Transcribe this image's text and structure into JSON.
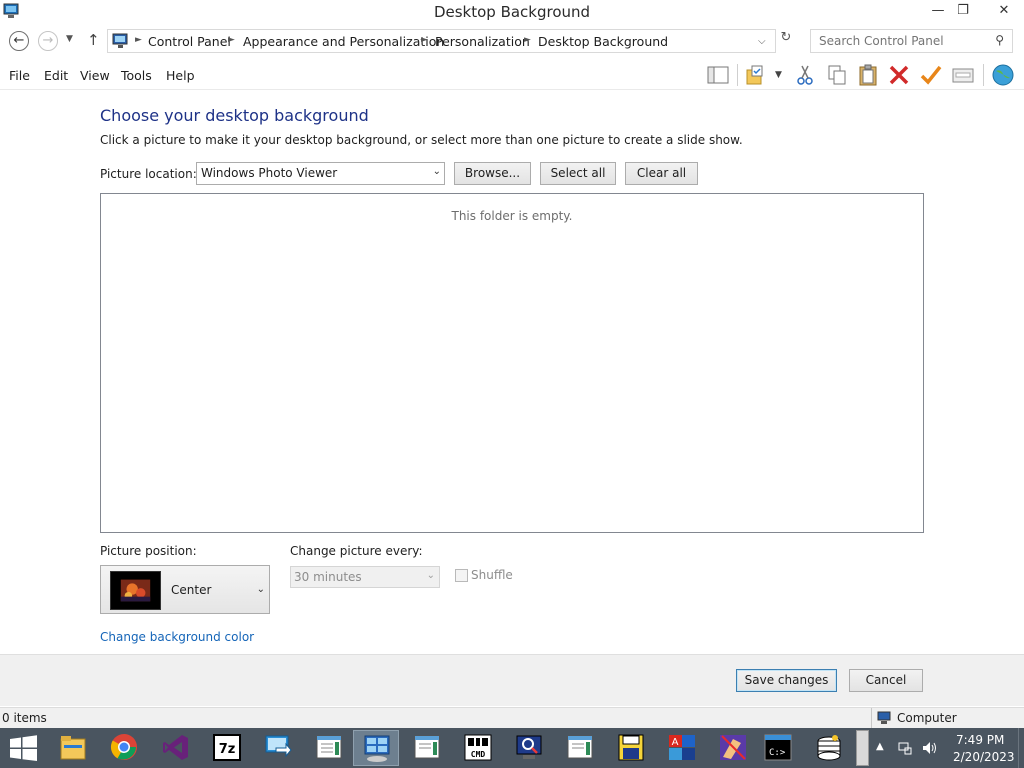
{
  "window": {
    "title": "Desktop Background"
  },
  "address_bar": {
    "breadcrumbs": [
      "Control Panel",
      "Appearance and Personalization",
      "Personalization",
      "Desktop Background"
    ],
    "search_placeholder": "Search Control Panel"
  },
  "menu": {
    "items": [
      "File",
      "Edit",
      "View",
      "Tools",
      "Help"
    ]
  },
  "toolbar": {
    "icons": [
      "layout-pane-icon",
      "folder-options-icon",
      "cut-icon",
      "copy-icon",
      "paste-icon",
      "delete-icon",
      "checkmark-icon",
      "properties-icon",
      "globe-icon"
    ]
  },
  "content": {
    "heading": "Choose your desktop background",
    "subtext": "Click a picture to make it your desktop background, or select more than one picture to create a slide show.",
    "picture_location_label": "Picture location:",
    "picture_location_value": "Windows Photo Viewer",
    "browse_label": "Browse...",
    "select_all_label": "Select all",
    "clear_all_label": "Clear all",
    "empty_message": "This folder is empty.",
    "picture_position_label": "Picture position:",
    "picture_position_value": "Center",
    "change_every_label": "Change picture every:",
    "change_every_value": "30 minutes",
    "shuffle_label": "Shuffle",
    "shuffle_checked": false,
    "change_bg_color_label": "Change background color"
  },
  "footer": {
    "save_label": "Save changes",
    "cancel_label": "Cancel"
  },
  "status_bar": {
    "items_text": "0 items",
    "location_text": "Computer"
  },
  "taskbar": {
    "apps": [
      "file-explorer-icon",
      "chrome-icon",
      "visual-studio-icon",
      "7zip-icon",
      "remote-desktop-icon",
      "notepad-icon",
      "control-panel-icon",
      "notepad-icon",
      "cmd-tool-icon",
      "magnifier-icon",
      "notepad-icon",
      "floppy-icon",
      "acrobat-icon",
      "paint-icon",
      "terminal-icon",
      "database-icon"
    ],
    "active_index": 6,
    "time": "7:49 PM",
    "date": "2/20/2023"
  },
  "colors": {
    "heading": "#1e3287",
    "link": "#1565b8",
    "taskbar": "#4a5560"
  }
}
